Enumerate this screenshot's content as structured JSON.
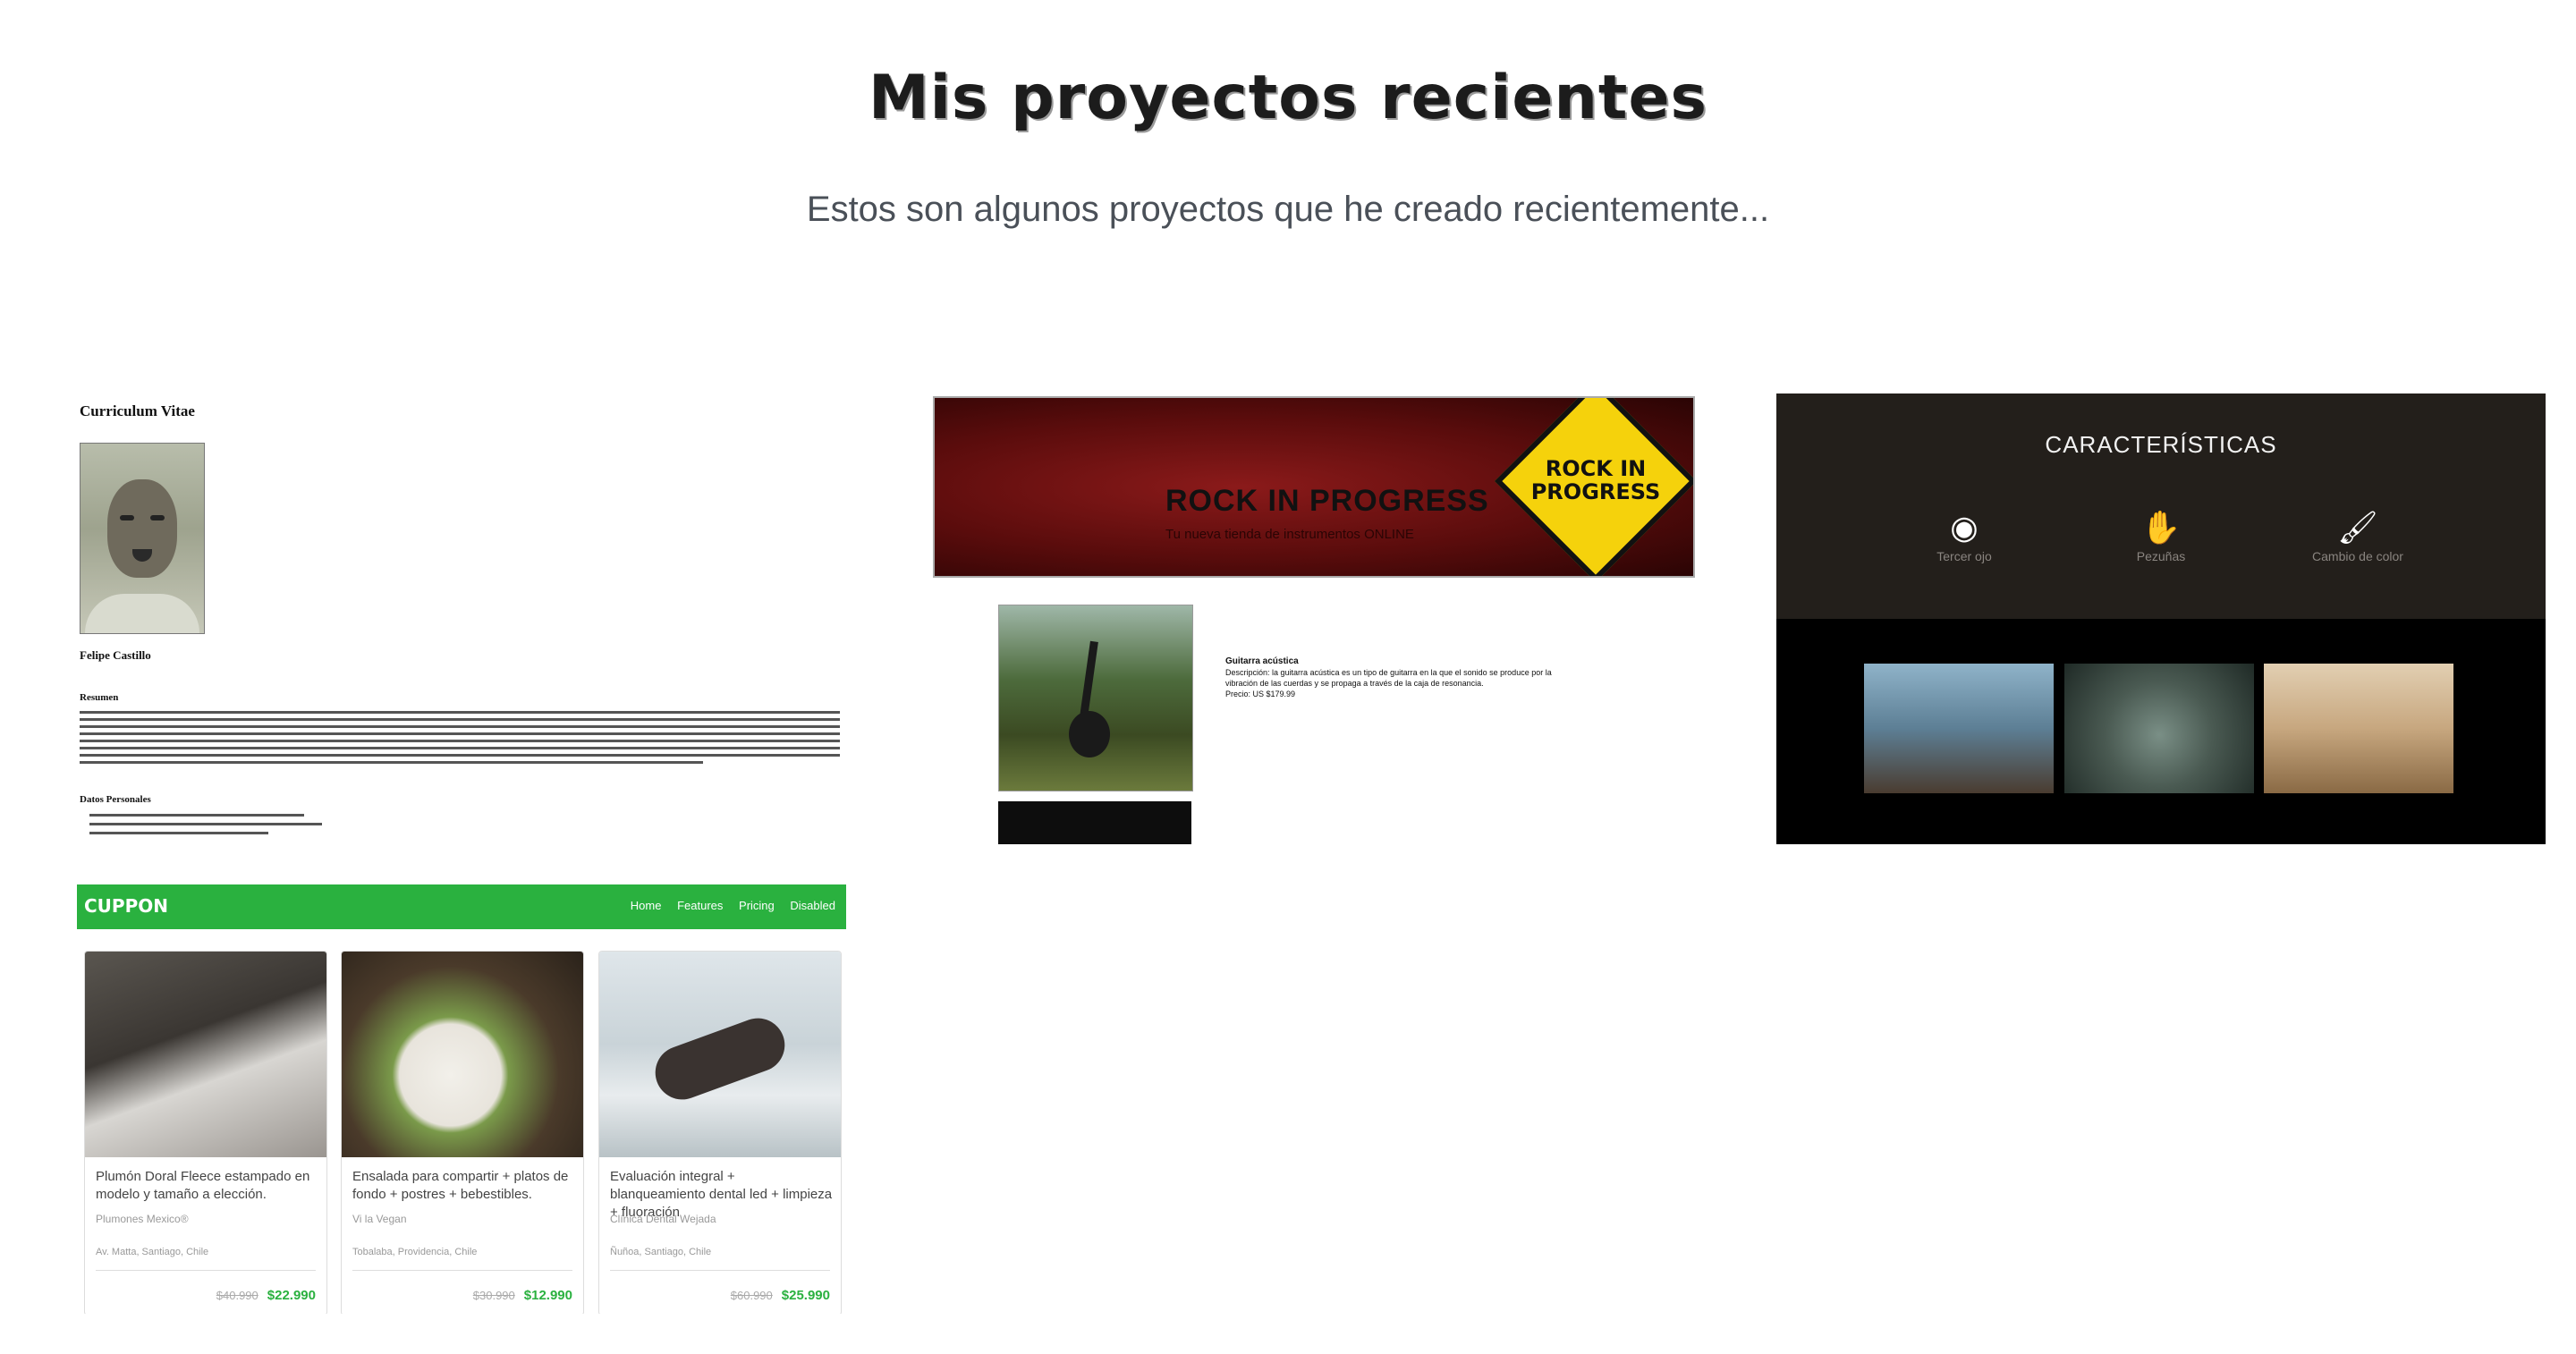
{
  "header": {
    "title": "Mis proyectos recientes",
    "subtitle": "Estos son algunos proyectos que he creado recientemente..."
  },
  "projects": {
    "cv": {
      "heading": "Curriculum Vitae",
      "name": "Felipe Castillo",
      "resumen": "Resumen",
      "datos": "Datos Personales"
    },
    "rock": {
      "title": "ROCK IN PROGRESS",
      "tagline": "Tu nueva tienda de instrumentos ONLINE",
      "sign": "ROCK IN PROGRESS",
      "product_name": "Guitarra acústica",
      "product_desc": "Descripción: la guitarra acústica es un tipo de guitarra en la que el sonido se produce por la vibración de las cuerdas y se propaga a través de la caja de resonancia.",
      "product_price": "Precio: US $179.99"
    },
    "caracteristicas": {
      "title": "CARACTERÍSTICAS",
      "features": [
        {
          "icon": "eye-icon",
          "label": "Tercer ojo"
        },
        {
          "icon": "hand-icon",
          "label": "Pezuñas"
        },
        {
          "icon": "brush-icon",
          "label": "Cambio de color"
        }
      ],
      "thumb_colors": [
        "#6f8fa6",
        "#4a5a52",
        "#c7a77f"
      ]
    },
    "cuppon": {
      "brand": "CUPPON",
      "nav": [
        "Home",
        "Features",
        "Pricing",
        "Disabled"
      ],
      "accent": "#2ab13f",
      "items": [
        {
          "desc": "Plumón Doral Fleece estampado en modelo y tamaño a elección.",
          "shop": "Plumones Mexico®",
          "location": "Av. Matta, Santiago, Chile",
          "old_price": "$40.990",
          "new_price": "$22.990"
        },
        {
          "desc": "Ensalada para compartir + platos de fondo + postres + bebestibles.",
          "shop": "Vi la Vegan",
          "location": "Tobalaba, Providencia, Chile",
          "old_price": "$30.990",
          "new_price": "$12.990"
        },
        {
          "desc": "Evaluación integral + blanqueamiento dental led + limpieza + fluoración",
          "shop": "Clínica Dental Wejada",
          "location": "Ñuñoa, Santiago, Chile",
          "old_price": "$60.990",
          "new_price": "$25.990"
        }
      ]
    }
  }
}
